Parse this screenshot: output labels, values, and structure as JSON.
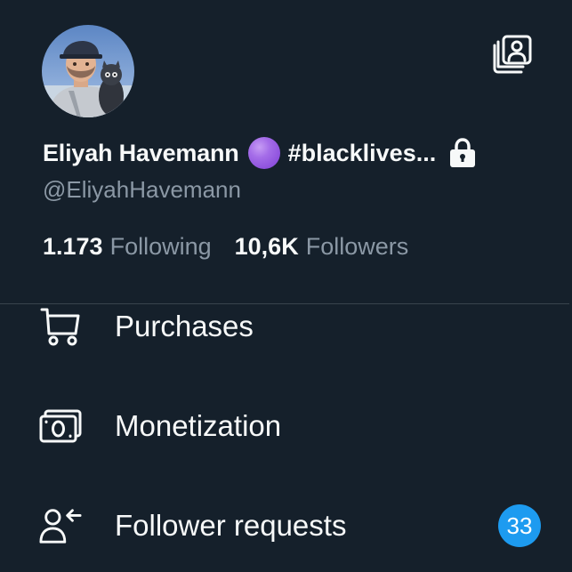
{
  "profile": {
    "display_name": "Eliyah Havemann",
    "hashtag": "#blacklives...",
    "handle": "@EliyahHavemann",
    "name_emoji": "purple-circle",
    "protected_icon": "lock-icon"
  },
  "stats": {
    "following_count": "1.173",
    "following_label": "Following",
    "followers_count": "10,6K",
    "followers_label": "Followers"
  },
  "menu": {
    "items": [
      {
        "label": "Purchases",
        "icon": "shopping-cart-icon"
      },
      {
        "label": "Monetization",
        "icon": "money-icon"
      },
      {
        "label": "Follower requests",
        "icon": "follower-requests-icon",
        "badge": "33"
      }
    ]
  },
  "colors": {
    "background": "#15202b",
    "text_primary": "#f7f9f9",
    "text_secondary": "#8b98a5",
    "divider": "#38444d",
    "accent": "#1d9bf0",
    "emoji_purple": "#a46ce8"
  }
}
